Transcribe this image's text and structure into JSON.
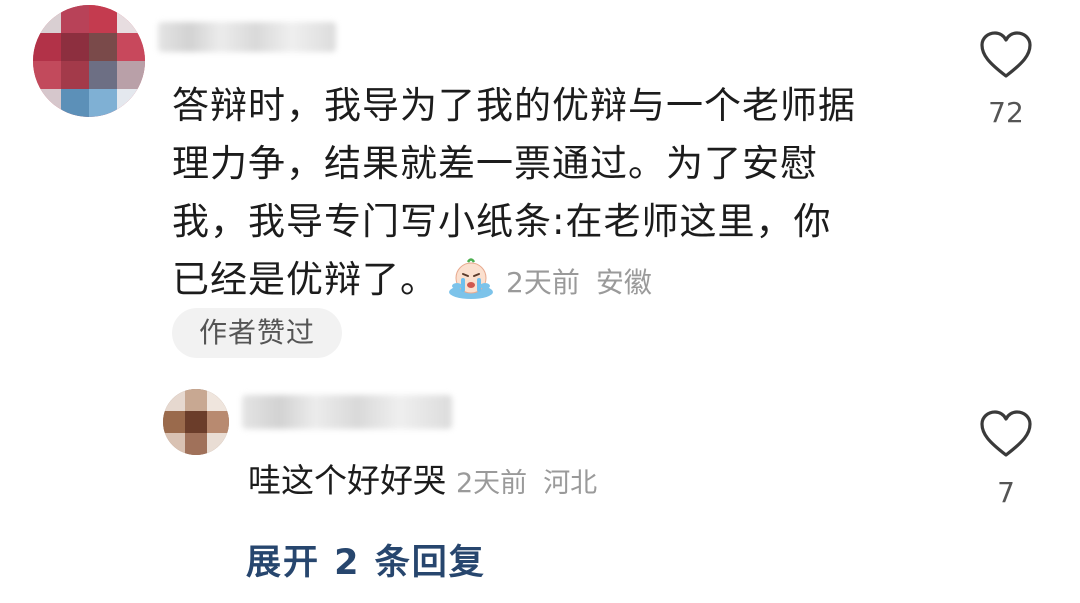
{
  "comment": {
    "lines": [
      "答辩时，我导为了我的优辩与一个老师据",
      "理力争，结果就差一票通过。为了安慰",
      "我，我导专门写小纸条:在老师这里，你",
      "已经是优辩了。"
    ],
    "emoji_icon": "crying-face-emoji",
    "time": "2天前",
    "location": "安徽",
    "badge": "作者赞过",
    "like_count": "72"
  },
  "reply": {
    "text": "哇这个好好哭",
    "time": "2天前",
    "location": "河北",
    "like_count": "7"
  },
  "expand_label": "展开 2 条回复",
  "colors": {
    "expand_link": "#27466e",
    "meta_text": "#9a9a9a",
    "badge_bg": "#f2f2f2"
  },
  "icons": [
    "avatar-pixelated",
    "heart-outline-icon",
    "crying-face-emoji"
  ]
}
